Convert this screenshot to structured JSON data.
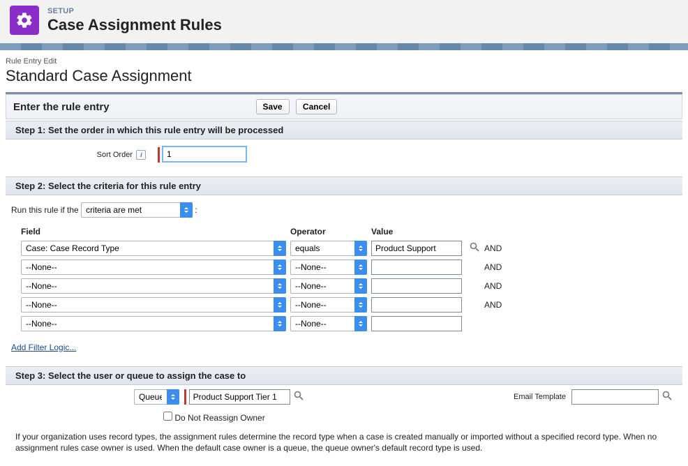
{
  "header": {
    "setup_label": "SETUP",
    "title": "Case Assignment Rules"
  },
  "breadcrumb": "Rule Entry Edit",
  "page_title": "Standard Case Assignment",
  "section": {
    "enter_label": "Enter the rule entry",
    "save_label": "Save",
    "cancel_label": "Cancel"
  },
  "step1": {
    "title": "Step 1: Set the order in which this rule entry will be processed",
    "sort_order_label": "Sort Order",
    "sort_order_value": "1"
  },
  "step2": {
    "title": "Step 2: Select the criteria for this rule entry",
    "run_label": "Run this rule if the",
    "criteria_select": "criteria are met",
    "columns": {
      "field": "Field",
      "operator": "Operator",
      "value": "Value"
    },
    "rows": [
      {
        "field": "Case: Case Record Type",
        "operator": "equals",
        "value": "Product Support",
        "join": "AND"
      },
      {
        "field": "--None--",
        "operator": "--None--",
        "value": "",
        "join": "AND"
      },
      {
        "field": "--None--",
        "operator": "--None--",
        "value": "",
        "join": "AND"
      },
      {
        "field": "--None--",
        "operator": "--None--",
        "value": "",
        "join": "AND"
      },
      {
        "field": "--None--",
        "operator": "--None--",
        "value": "",
        "join": ""
      }
    ],
    "filter_link": "Add Filter Logic..."
  },
  "step3": {
    "title": "Step 3: Select the user or queue to assign the case to",
    "assign_type": "Queue",
    "assign_value": "Product Support Tier 1",
    "email_template_label": "Email Template",
    "email_template_value": "",
    "do_not_reassign_label": "Do Not Reassign Owner"
  },
  "footnote": "If your organization uses record types, the assignment rules determine the record type when a case is created manually or imported without a specified record type. When no assignment rules case owner is used. When the default case owner is a queue, the queue owner's default record type is used."
}
